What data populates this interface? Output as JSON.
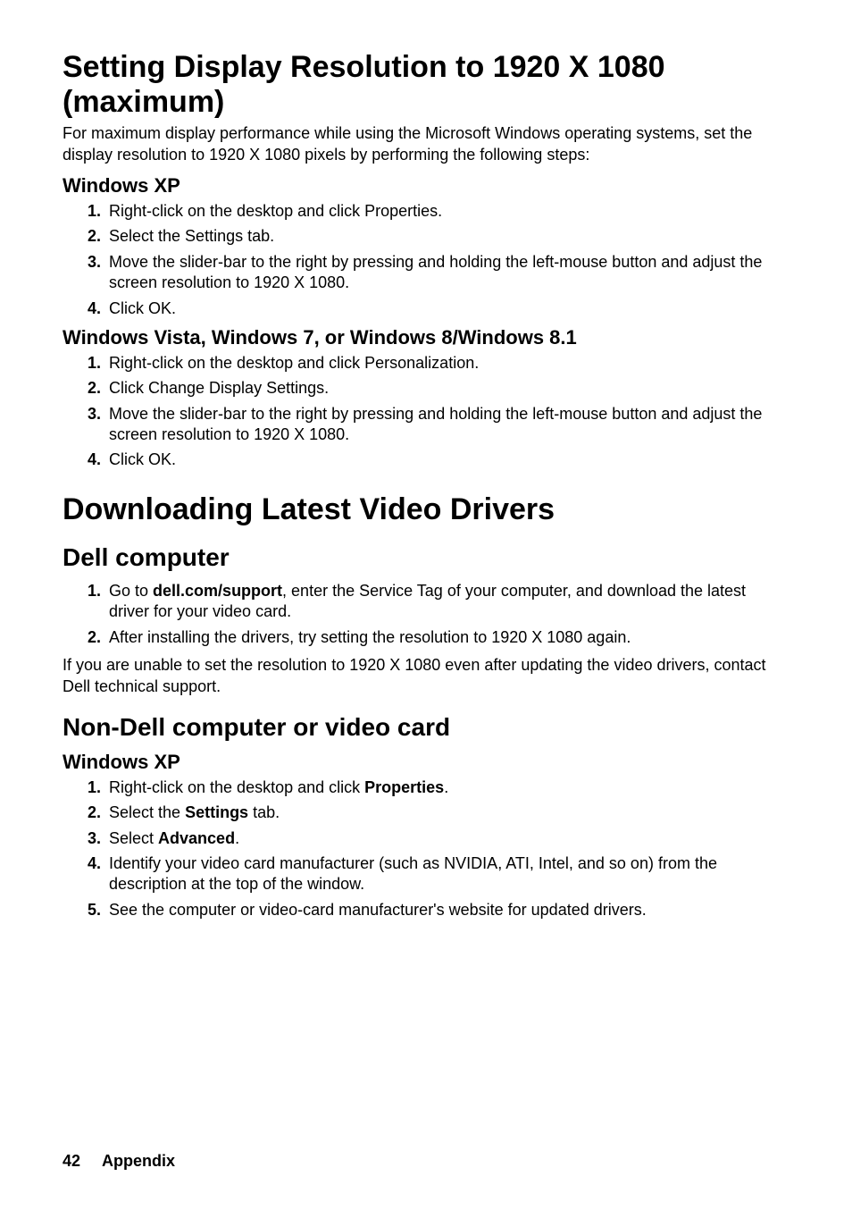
{
  "section1": {
    "title": "Setting Display Resolution to 1920 X 1080 (maximum)",
    "intro": "For maximum display performance while using the Microsoft Windows operating systems, set the display resolution to 1920 X 1080 pixels by performing the following steps:",
    "xp": {
      "heading": "Windows XP",
      "steps": [
        "Right-click on the desktop and click Properties.",
        "Select the Settings tab.",
        "Move the slider-bar to the right by pressing and holding the left-mouse button and adjust the screen resolution to 1920 X 1080.",
        "Click OK."
      ]
    },
    "vista": {
      "heading": "Windows Vista, Windows 7, or Windows 8/Windows 8.1",
      "steps": [
        "Right-click on the desktop and click Personalization.",
        "Click Change Display Settings.",
        "Move the slider-bar to the right by pressing and holding the left-mouse button and adjust the screen resolution to 1920 X 1080.",
        "Click OK."
      ]
    }
  },
  "section2": {
    "title": "Downloading Latest Video Drivers",
    "dell": {
      "heading": "Dell computer",
      "steps": [
        {
          "pre": "Go to ",
          "bold": "dell.com/support",
          "post": ", enter the Service Tag of your computer, and download the latest driver for your video card."
        },
        {
          "text": "After installing the drivers, try setting the resolution to 1920 X 1080 again."
        }
      ],
      "after": "If you are unable to set the resolution to 1920 X 1080 even after updating the video drivers, contact Dell technical support."
    },
    "nondell": {
      "heading": "Non-Dell computer or video card",
      "xp": {
        "heading": "Windows XP",
        "steps": [
          {
            "pre": "Right-click on the desktop and click ",
            "bold": "Properties",
            "post": "."
          },
          {
            "pre": "Select the ",
            "bold": "Settings",
            "post": " tab."
          },
          {
            "pre": "Select ",
            "bold": "Advanced",
            "post": "."
          },
          {
            "text": "Identify your video card manufacturer (such as NVIDIA, ATI, Intel, and so on) from the description at the top of the window."
          },
          {
            "text": "See the computer or video-card manufacturer's website for updated drivers."
          }
        ]
      }
    }
  },
  "footer": {
    "page": "42",
    "label": "Appendix"
  }
}
